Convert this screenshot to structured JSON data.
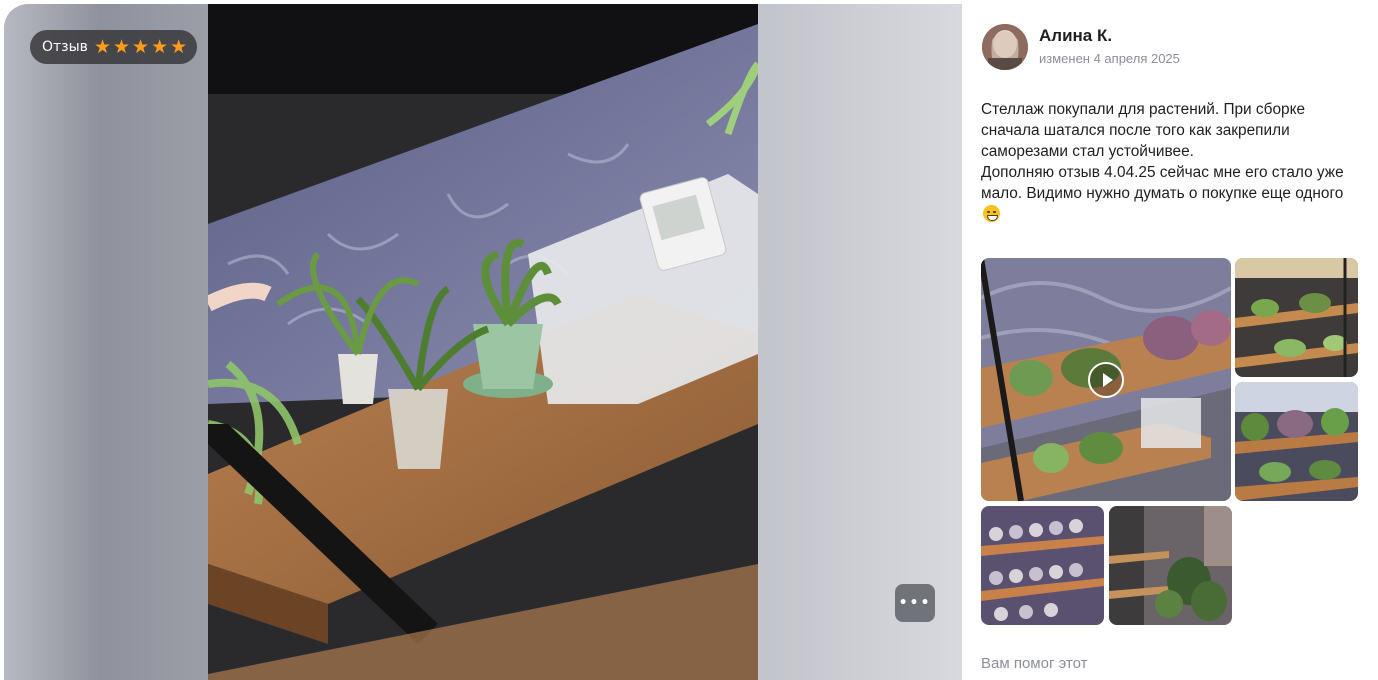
{
  "viewer": {
    "rating_label": "Отзыв",
    "rating_stars": 5,
    "more_label": "•••"
  },
  "review": {
    "author": "Алина К.",
    "edited": "изменен 4 апреля 2025",
    "text_lines": [
      "Стеллаж покупали для растений. При сборке сначала шатался после того как закрепили саморезами стал устойчивее.",
      "Дополняю отзыв 4.04.25 сейчас мне его стало уже мало. Видимо нужно думать о покупке еще одного"
    ],
    "emoji": "grinning-sweat-emoji",
    "helpful_prompt": "Вам помог этот"
  },
  "gallery": {
    "items": [
      {
        "type": "video",
        "icon": "play-icon"
      },
      {
        "type": "photo"
      },
      {
        "type": "photo"
      },
      {
        "type": "photo"
      },
      {
        "type": "photo"
      }
    ]
  },
  "colors": {
    "star": "#ff9d1a",
    "text": "#1f1f22",
    "muted": "#8b8e99"
  }
}
